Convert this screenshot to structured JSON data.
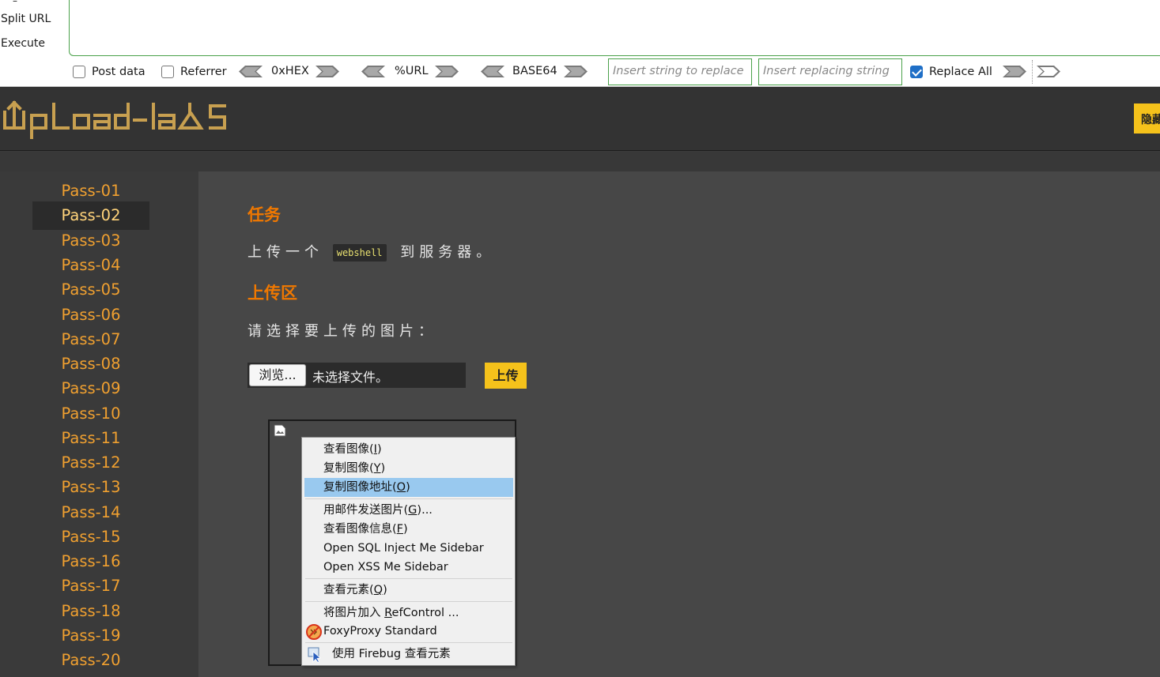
{
  "hackbar": {
    "commands": {
      "split": "Split URL",
      "execute": "Execute"
    },
    "post_data_label": "Post data",
    "post_data_checked": false,
    "referrer_label": "Referrer",
    "referrer_checked": false,
    "encoders": [
      "0xHEX",
      "%URL",
      "BASE64"
    ],
    "replace_placeholder": "Insert string to replace",
    "replacing_placeholder": "Insert replacing string",
    "replace_all_label": "Replace All",
    "replace_all_checked": true
  },
  "header": {
    "logo_text": "Upload-labs",
    "hide_button": "隐藏"
  },
  "sidebar": {
    "active": "Pass-02",
    "items": [
      "Pass-01",
      "Pass-02",
      "Pass-03",
      "Pass-04",
      "Pass-05",
      "Pass-06",
      "Pass-07",
      "Pass-08",
      "Pass-09",
      "Pass-10",
      "Pass-11",
      "Pass-12",
      "Pass-13",
      "Pass-14",
      "Pass-15",
      "Pass-16",
      "Pass-17",
      "Pass-18",
      "Pass-19",
      "Pass-20"
    ]
  },
  "main": {
    "task_title": "任务",
    "task_before": "上传一个",
    "task_code": "webshell",
    "task_after": "到服务器。",
    "upload_title": "上传区",
    "choose_label": "请选择要上传的图片：",
    "browse_button": "浏览...",
    "file_status": "未选择文件。",
    "upload_button": "上传"
  },
  "context_menu": {
    "items": [
      {
        "label": "查看图像(",
        "key": "I",
        "tail": ")"
      },
      {
        "label": "复制图像(",
        "key": "Y",
        "tail": ")"
      },
      {
        "label": "复制图像地址(",
        "key": "O",
        "tail": ")",
        "highlighted": true
      },
      {
        "label": "用邮件发送图片(",
        "key": "G",
        "tail": ")..."
      },
      {
        "label": "查看图像信息(",
        "key": "F",
        "tail": ")"
      },
      {
        "label": "Open SQL Inject Me Sidebar",
        "key": "",
        "tail": ""
      },
      {
        "label": "Open XSS Me Sidebar",
        "key": "",
        "tail": ""
      },
      {
        "label": "查看元素(",
        "key": "Q",
        "tail": ")"
      },
      {
        "label": "将图片加入 ",
        "key": "R",
        "tail": "efControl ..."
      },
      {
        "label": "FoxyProxy Standard",
        "key": "",
        "tail": "",
        "icon": "foxyproxy-icon"
      },
      {
        "label": "使用 Firebug 查看元素",
        "key": "",
        "tail": "",
        "icon": "firebug-icon"
      }
    ]
  },
  "colors": {
    "accent_orange": "#f07800",
    "button_yellow": "#f5c21b",
    "sidebar_link": "#f0a030",
    "menu_highlight": "#99c9ef"
  }
}
